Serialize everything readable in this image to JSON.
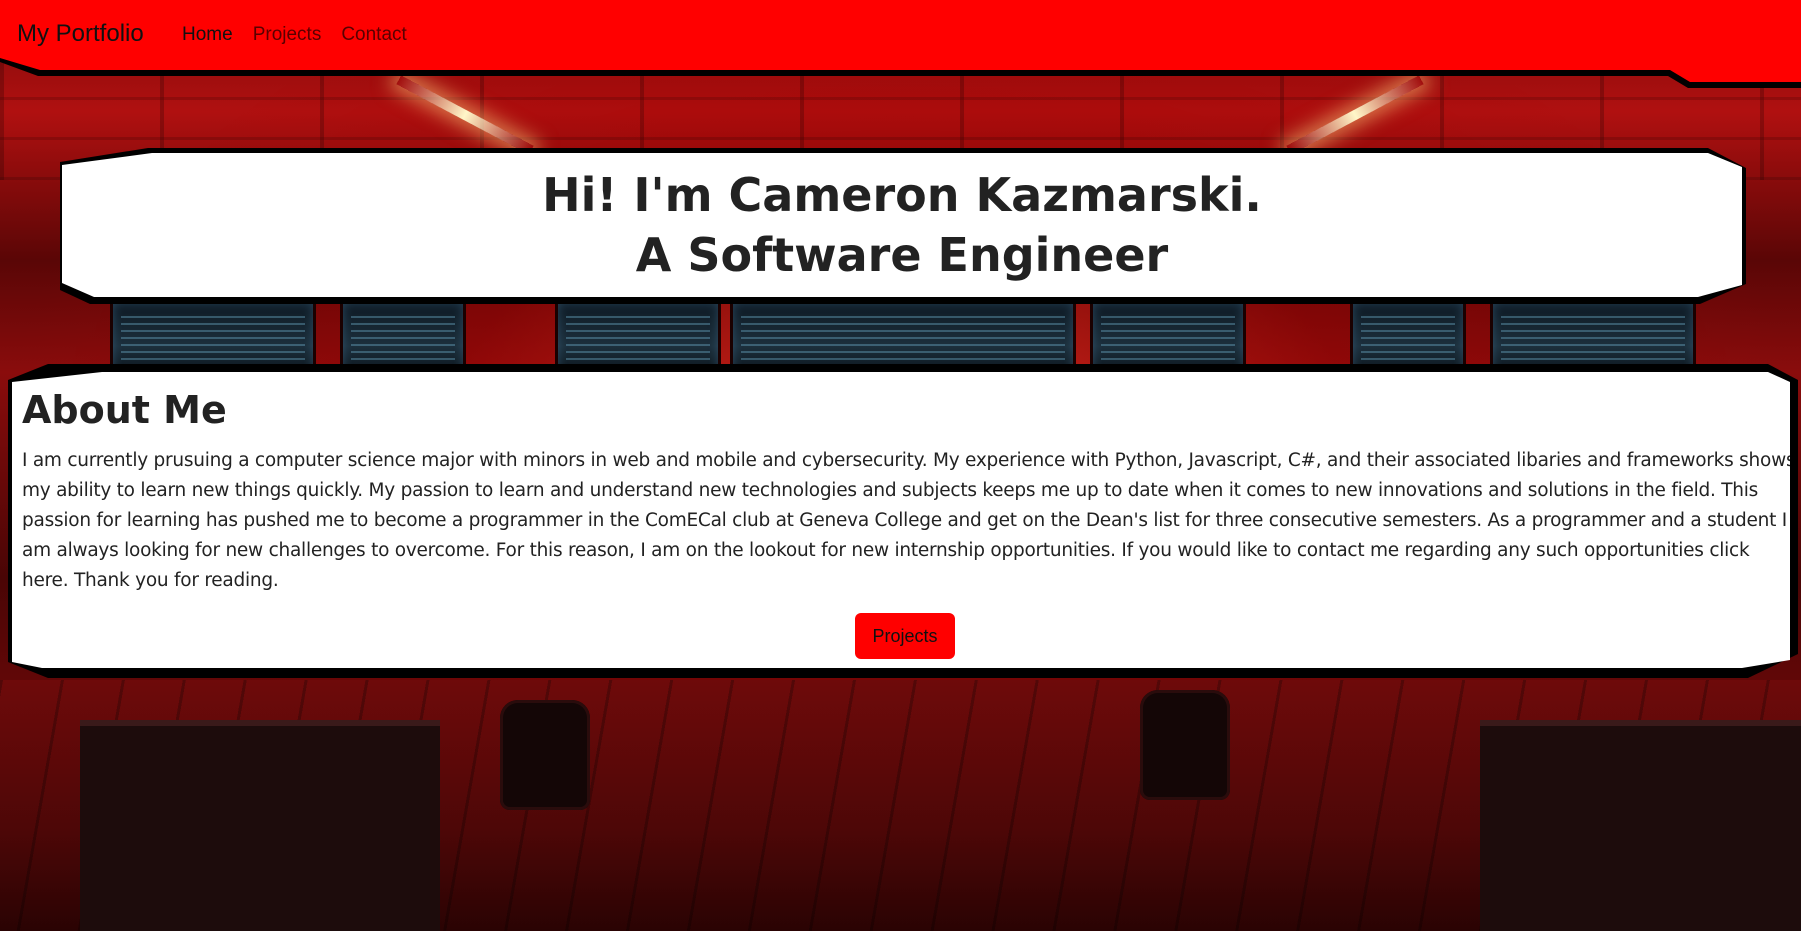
{
  "navbar": {
    "brand": "My Portfolio",
    "links": [
      {
        "label": "Home"
      },
      {
        "label": "Projects"
      },
      {
        "label": "Contact"
      }
    ]
  },
  "hero": {
    "line1": "Hi! I'm Cameron Kazmarski.",
    "line2": "A Software Engineer"
  },
  "about": {
    "title": "About Me",
    "text": "I am currently prusuing a computer science major with minors in web and mobile and cybersecurity. My experience with Python, Javascript, C#, and their associated libaries and frameworks shows my ability to learn new things quickly. My passion to learn and understand new technologies and subjects keeps me up to date when it comes to new innovations and solutions in the field. This passion for learning has pushed me to become a programmer in the ComECal club at Geneva College and get on the Dean's list for three consecutive semesters. As a programmer and a student I am always looking for new challenges to overcome. For this reason, I am on the lookout for new internship opportunities. If you would like to contact me regarding any such opportunities click here. Thank you for reading.",
    "button_label": "Projects"
  },
  "colors": {
    "navbar": "#ff0000",
    "card": "#ffffff",
    "button": "#ff0000",
    "text": "#222222"
  }
}
